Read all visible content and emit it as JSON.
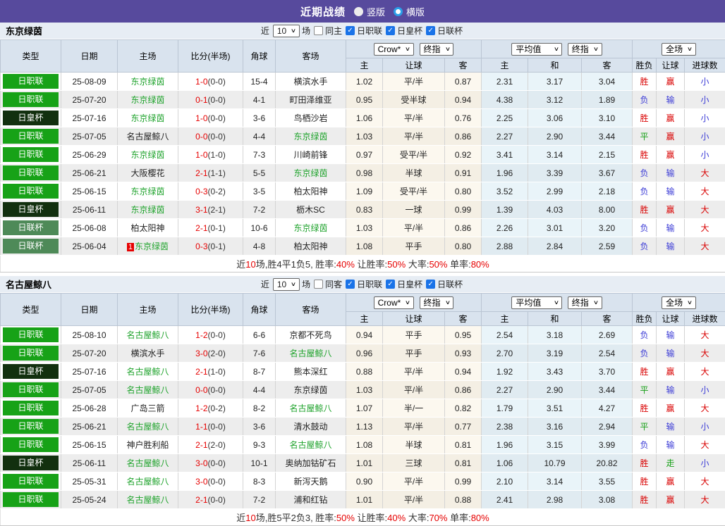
{
  "titlebar": {
    "title": "近期战绩",
    "radio_vertical": "竖版",
    "radio_vertical_checked": false,
    "radio_horizontal": "横版",
    "radio_horizontal_checked": true
  },
  "hdr": {
    "type": "类型",
    "date": "日期",
    "home": "主场",
    "score": "比分(半场)",
    "corner": "角球",
    "away": "客场",
    "crow": "Crow*",
    "final1": "终指",
    "avg": "平均值",
    "final2": "终指",
    "scope": "全场",
    "sub_home": "主",
    "sub_handicap": "让球",
    "sub_away": "客",
    "sub_home2": "主",
    "sub_draw": "和",
    "sub_away2": "客",
    "sub_wdl": "胜负",
    "sub_hcp": "让球",
    "sub_goals": "进球数"
  },
  "colors": {
    "topbar": "#574a9d",
    "league_jl": "#17a217",
    "league_cup": "#12300f",
    "league_lcup": "#4e8a58",
    "team_highlight": "#1fa32c",
    "score_red": "#e60000",
    "win_red": "#d90000",
    "lose_blue": "#3b3bd6",
    "draw_green": "#18a018",
    "checkbox_blue": "#1a73e8"
  },
  "row_fields": [
    "league",
    "league_type",
    "date",
    "home",
    "home_hl",
    "home_badge",
    "score",
    "half_score",
    "corner",
    "away",
    "away_hl",
    "odds_home",
    "handicap",
    "odds_away",
    "avg_home",
    "avg_draw",
    "avg_away",
    "result_wdl",
    "result_wdl_color",
    "result_handicap",
    "result_handicap_color",
    "result_goals",
    "result_goals_color"
  ],
  "sections": [
    {
      "team": "东京绿茵",
      "filter": {
        "near_label": "近",
        "count": "10",
        "games_label": "场",
        "same_label": "同主",
        "same_checked": false,
        "leagues": [
          {
            "label": "日职联",
            "checked": true
          },
          {
            "label": "日皇杯",
            "checked": true
          },
          {
            "label": "日联杯",
            "checked": true
          }
        ]
      },
      "rows": [
        [
          "日职联",
          "jl",
          "25-08-09",
          "东京绿茵",
          1,
          "",
          "1-0",
          "(0-0)",
          "15-4",
          "横滨水手",
          0,
          "1.02",
          "平/半",
          "0.87",
          "2.31",
          "3.17",
          "3.04",
          "胜",
          "r",
          "赢",
          "r",
          "小",
          "b"
        ],
        [
          "日职联",
          "jl",
          "25-07-20",
          "东京绿茵",
          1,
          "",
          "0-1",
          "(0-0)",
          "4-1",
          "町田泽维亚",
          0,
          "0.95",
          "受半球",
          "0.94",
          "4.38",
          "3.12",
          "1.89",
          "负",
          "b",
          "输",
          "b",
          "小",
          "b"
        ],
        [
          "日皇杯",
          "cup",
          "25-07-16",
          "东京绿茵",
          1,
          "",
          "1-0",
          "(0-0)",
          "3-6",
          "鸟栖沙岩",
          0,
          "1.06",
          "平/半",
          "0.76",
          "2.25",
          "3.06",
          "3.10",
          "胜",
          "r",
          "赢",
          "r",
          "小",
          "b"
        ],
        [
          "日职联",
          "jl",
          "25-07-05",
          "名古屋鲸八",
          0,
          "",
          "0-0",
          "(0-0)",
          "4-4",
          "东京绿茵",
          1,
          "1.03",
          "平/半",
          "0.86",
          "2.27",
          "2.90",
          "3.44",
          "平",
          "g",
          "赢",
          "r",
          "小",
          "b"
        ],
        [
          "日职联",
          "jl",
          "25-06-29",
          "东京绿茵",
          1,
          "",
          "1-0",
          "(1-0)",
          "7-3",
          "川崎前锋",
          0,
          "0.97",
          "受平/半",
          "0.92",
          "3.41",
          "3.14",
          "2.15",
          "胜",
          "r",
          "赢",
          "r",
          "小",
          "b"
        ],
        [
          "日职联",
          "jl",
          "25-06-21",
          "大阪樱花",
          0,
          "",
          "2-1",
          "(1-1)",
          "5-5",
          "东京绿茵",
          1,
          "0.98",
          "半球",
          "0.91",
          "1.96",
          "3.39",
          "3.67",
          "负",
          "b",
          "输",
          "b",
          "大",
          "r"
        ],
        [
          "日职联",
          "jl",
          "25-06-15",
          "东京绿茵",
          1,
          "",
          "0-3",
          "(0-2)",
          "3-5",
          "柏太阳神",
          0,
          "1.09",
          "受平/半",
          "0.80",
          "3.52",
          "2.99",
          "2.18",
          "负",
          "b",
          "输",
          "b",
          "大",
          "r"
        ],
        [
          "日皇杯",
          "cup",
          "25-06-11",
          "东京绿茵",
          1,
          "",
          "3-1",
          "(2-1)",
          "7-2",
          "枥木SC",
          0,
          "0.83",
          "一球",
          "0.99",
          "1.39",
          "4.03",
          "8.00",
          "胜",
          "r",
          "赢",
          "r",
          "大",
          "r"
        ],
        [
          "日联杯",
          "lcup",
          "25-06-08",
          "柏太阳神",
          0,
          "",
          "2-1",
          "(0-1)",
          "10-6",
          "东京绿茵",
          1,
          "1.03",
          "平/半",
          "0.86",
          "2.26",
          "3.01",
          "3.20",
          "负",
          "b",
          "输",
          "b",
          "大",
          "r"
        ],
        [
          "日联杯",
          "lcup",
          "25-06-04",
          "东京绿茵",
          1,
          "1",
          "0-3",
          "(0-1)",
          "4-8",
          "柏太阳神",
          0,
          "1.08",
          "平手",
          "0.80",
          "2.88",
          "2.84",
          "2.59",
          "负",
          "b",
          "输",
          "b",
          "大",
          "r"
        ]
      ],
      "summary": [
        {
          "t": "近"
        },
        {
          "t": "10",
          "r": 1
        },
        {
          "t": "场,胜4平1负5, 胜率:"
        },
        {
          "t": "40%",
          "r": 1
        },
        {
          "t": " 让胜率:"
        },
        {
          "t": "50%",
          "r": 1
        },
        {
          "t": " 大率:"
        },
        {
          "t": "50%",
          "r": 1
        },
        {
          "t": " 单率:"
        },
        {
          "t": "80%",
          "r": 1
        }
      ]
    },
    {
      "team": "名古屋鲸八",
      "filter": {
        "near_label": "近",
        "count": "10",
        "games_label": "场",
        "same_label": "同客",
        "same_checked": false,
        "leagues": [
          {
            "label": "日职联",
            "checked": true
          },
          {
            "label": "日皇杯",
            "checked": true
          },
          {
            "label": "日联杯",
            "checked": true
          }
        ]
      },
      "rows": [
        [
          "日职联",
          "jl",
          "25-08-10",
          "名古屋鲸八",
          1,
          "",
          "1-2",
          "(0-0)",
          "6-6",
          "京都不死鸟",
          0,
          "0.94",
          "平手",
          "0.95",
          "2.54",
          "3.18",
          "2.69",
          "负",
          "b",
          "输",
          "b",
          "大",
          "r"
        ],
        [
          "日职联",
          "jl",
          "25-07-20",
          "横滨水手",
          0,
          "",
          "3-0",
          "(2-0)",
          "7-6",
          "名古屋鲸八",
          1,
          "0.96",
          "平手",
          "0.93",
          "2.70",
          "3.19",
          "2.54",
          "负",
          "b",
          "输",
          "b",
          "大",
          "r"
        ],
        [
          "日皇杯",
          "cup",
          "25-07-16",
          "名古屋鲸八",
          1,
          "",
          "2-1",
          "(1-0)",
          "8-7",
          "熊本深红",
          0,
          "0.88",
          "平/半",
          "0.94",
          "1.92",
          "3.43",
          "3.70",
          "胜",
          "r",
          "赢",
          "r",
          "大",
          "r"
        ],
        [
          "日职联",
          "jl",
          "25-07-05",
          "名古屋鲸八",
          1,
          "",
          "0-0",
          "(0-0)",
          "4-4",
          "东京绿茵",
          0,
          "1.03",
          "平/半",
          "0.86",
          "2.27",
          "2.90",
          "3.44",
          "平",
          "g",
          "输",
          "b",
          "小",
          "b"
        ],
        [
          "日职联",
          "jl",
          "25-06-28",
          "广岛三箭",
          0,
          "",
          "1-2",
          "(0-2)",
          "8-2",
          "名古屋鲸八",
          1,
          "1.07",
          "半/一",
          "0.82",
          "1.79",
          "3.51",
          "4.27",
          "胜",
          "r",
          "赢",
          "r",
          "大",
          "r"
        ],
        [
          "日职联",
          "jl",
          "25-06-21",
          "名古屋鲸八",
          1,
          "",
          "1-1",
          "(0-0)",
          "3-6",
          "清水鼓动",
          0,
          "1.13",
          "平/半",
          "0.77",
          "2.38",
          "3.16",
          "2.94",
          "平",
          "g",
          "输",
          "b",
          "小",
          "b"
        ],
        [
          "日职联",
          "jl",
          "25-06-15",
          "神户胜利船",
          0,
          "",
          "2-1",
          "(2-0)",
          "9-3",
          "名古屋鲸八",
          1,
          "1.08",
          "半球",
          "0.81",
          "1.96",
          "3.15",
          "3.99",
          "负",
          "b",
          "输",
          "b",
          "大",
          "r"
        ],
        [
          "日皇杯",
          "cup",
          "25-06-11",
          "名古屋鲸八",
          1,
          "",
          "3-0",
          "(0-0)",
          "10-1",
          "奥纳加钴矿石",
          0,
          "1.01",
          "三球",
          "0.81",
          "1.06",
          "10.79",
          "20.82",
          "胜",
          "r",
          "走",
          "g",
          "小",
          "b"
        ],
        [
          "日职联",
          "jl",
          "25-05-31",
          "名古屋鲸八",
          1,
          "",
          "3-0",
          "(0-0)",
          "8-3",
          "新泻天鹅",
          0,
          "0.90",
          "平/半",
          "0.99",
          "2.10",
          "3.14",
          "3.55",
          "胜",
          "r",
          "赢",
          "r",
          "大",
          "r"
        ],
        [
          "日职联",
          "jl",
          "25-05-24",
          "名古屋鲸八",
          1,
          "",
          "2-1",
          "(0-0)",
          "7-2",
          "浦和红钻",
          0,
          "1.01",
          "平/半",
          "0.88",
          "2.41",
          "2.98",
          "3.08",
          "胜",
          "r",
          "赢",
          "r",
          "大",
          "r"
        ]
      ],
      "summary": [
        {
          "t": "近"
        },
        {
          "t": "10",
          "r": 1
        },
        {
          "t": "场,胜5平2负3, 胜率:"
        },
        {
          "t": "50%",
          "r": 1
        },
        {
          "t": " 让胜率:"
        },
        {
          "t": "40%",
          "r": 1
        },
        {
          "t": " 大率:"
        },
        {
          "t": "70%",
          "r": 1
        },
        {
          "t": " 单率:"
        },
        {
          "t": "80%",
          "r": 1
        }
      ]
    }
  ]
}
